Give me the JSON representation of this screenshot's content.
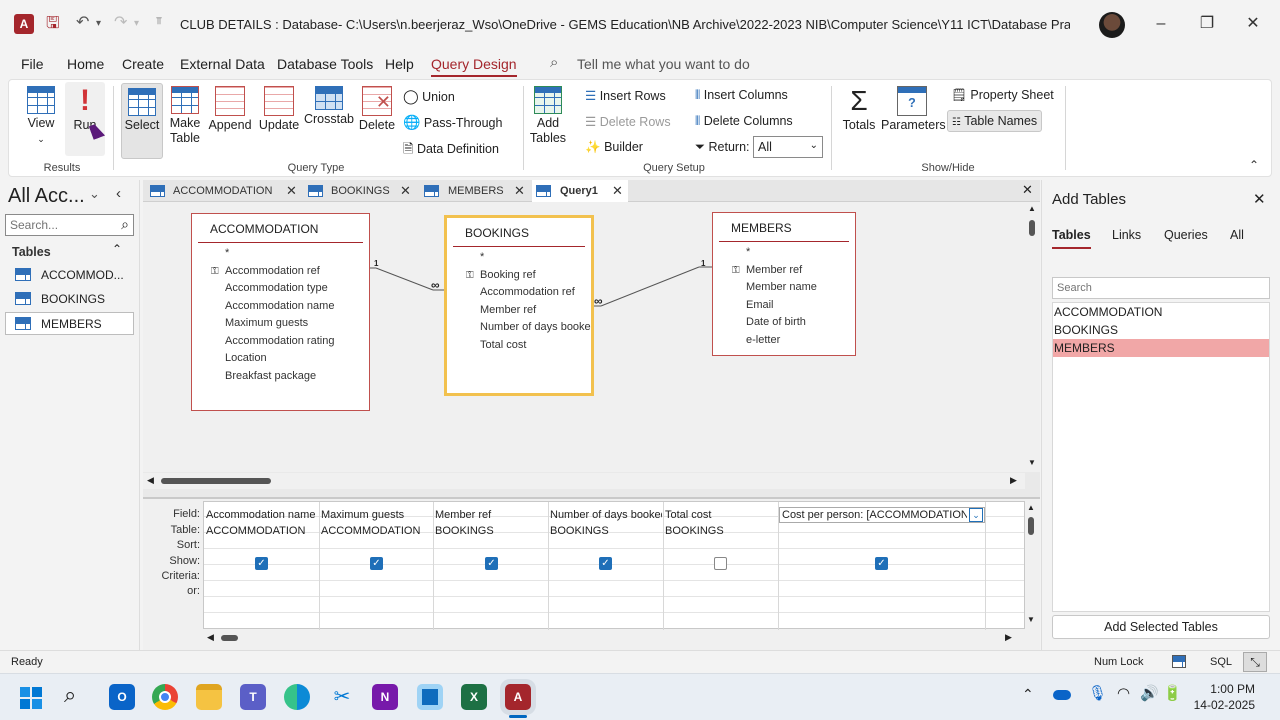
{
  "titlebar": {
    "title": "CLUB DETAILS : Database- C:\\Users\\n.beerjeraz_Wso\\OneDrive - GEMS Education\\NB Archive\\2022-2023 NIB\\Computer Science\\Y11 ICT\\Database Practice\\CLUB DE (..."
  },
  "menu": {
    "items": [
      "File",
      "Home",
      "Create",
      "External Data",
      "Database Tools",
      "Help",
      "Query Design"
    ],
    "tell_me": "Tell me what you want to do"
  },
  "ribbon": {
    "view": "View",
    "run": "Run",
    "results": "Results",
    "select": "Select",
    "make_table": "Make Table",
    "append": "Append",
    "update": "Update",
    "crosstab": "Crosstab",
    "delete": "Delete",
    "union": "Union",
    "pass_through": "Pass-Through",
    "data_definition": "Data Definition",
    "query_type": "Query Type",
    "add_tables": "Add Tables",
    "insert_rows": "Insert Rows",
    "delete_rows": "Delete Rows",
    "builder": "Builder",
    "insert_columns": "Insert Columns",
    "delete_columns": "Delete Columns",
    "return_label": "Return:",
    "return_value": "All",
    "query_setup": "Query Setup",
    "totals": "Totals",
    "parameters": "Parameters",
    "property_sheet": "Property Sheet",
    "table_names": "Table Names",
    "show_hide": "Show/Hide"
  },
  "nav": {
    "title": "All Acc...",
    "search_placeholder": "Search...",
    "section": "Tables",
    "items": [
      "ACCOMMOD...",
      "BOOKINGS",
      "MEMBERS"
    ]
  },
  "tabs": [
    "ACCOMMODATION",
    "BOOKINGS",
    "MEMBERS",
    "Query1"
  ],
  "tables": {
    "accommodation": {
      "name": "ACCOMMODATION",
      "fields": [
        "*",
        "Accommodation ref",
        "Accommodation type",
        "Accommodation name",
        "Maximum guests",
        "Accommodation rating",
        "Location",
        "Breakfast package"
      ]
    },
    "bookings": {
      "name": "BOOKINGS",
      "fields": [
        "*",
        "Booking ref",
        "Accommodation ref",
        "Member ref",
        "Number of days booke",
        "Total cost"
      ]
    },
    "members": {
      "name": "MEMBERS",
      "fields": [
        "*",
        "Member ref",
        "Member name",
        "Email",
        "Date of birth",
        "e-letter"
      ]
    },
    "rel_one": "1",
    "rel_many": "∞"
  },
  "grid": {
    "row_labels": [
      "Field:",
      "Table:",
      "Sort:",
      "Show:",
      "Criteria:",
      "or:"
    ],
    "columns": [
      {
        "field": "Accommodation name",
        "table": "ACCOMMODATION",
        "show": true
      },
      {
        "field": "Maximum guests",
        "table": "ACCOMMODATION",
        "show": true
      },
      {
        "field": "Member ref",
        "table": "BOOKINGS",
        "show": true
      },
      {
        "field": "Number of days booked",
        "table": "BOOKINGS",
        "show": true
      },
      {
        "field": "Total cost",
        "table": "BOOKINGS",
        "show": false
      },
      {
        "field": "Cost per person: [ACCOMMODATION]![M",
        "table": "",
        "show": true
      }
    ]
  },
  "addpane": {
    "title": "Add Tables",
    "tabs": [
      "Tables",
      "Links",
      "Queries",
      "All"
    ],
    "search_placeholder": "Search",
    "items": [
      "ACCOMMODATION",
      "BOOKINGS",
      "MEMBERS"
    ],
    "button": "Add Selected Tables"
  },
  "status": {
    "ready": "Ready",
    "num_lock": "Num Lock",
    "sql": "SQL"
  },
  "taskbar": {
    "time": "1:00 PM",
    "date": "14-02-2025"
  },
  "colors": {
    "accent": "#a4262c",
    "selected_item": "#f1a7a7",
    "checkbox": "#1f6fb8"
  }
}
